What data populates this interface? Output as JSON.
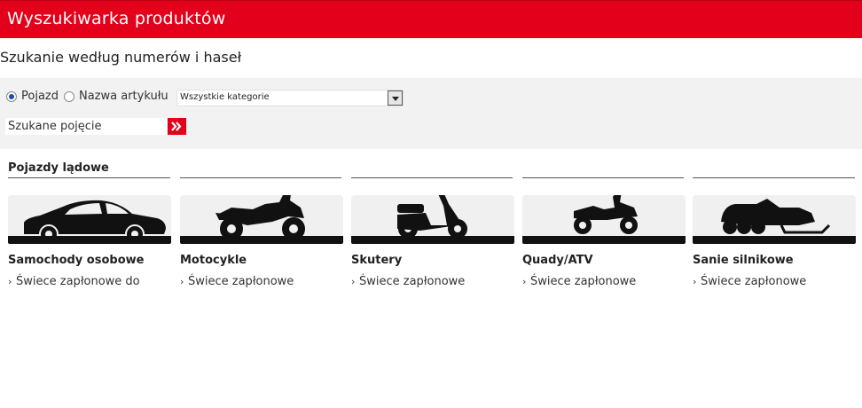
{
  "header": {
    "title": "Wyszukiwarka produktów"
  },
  "subtitle": "Szukanie według numerów i haseł",
  "search": {
    "radio_vehicle": "Pojazd",
    "radio_article": "Nazwa artykułu",
    "category_selected": "Wszystkie kategorie",
    "input_placeholder": "Szukane pojęcie"
  },
  "section": {
    "title": "Pojazdy lądowe"
  },
  "categories": [
    {
      "title": "Samochody osobowe",
      "link": "Świece zapłonowe do",
      "icon": "car-icon"
    },
    {
      "title": "Motocykle",
      "link": "Świece zapłonowe",
      "icon": "motorcycle-icon"
    },
    {
      "title": "Skutery",
      "link": "Świece zapłonowe",
      "icon": "scooter-icon"
    },
    {
      "title": "Quady/ATV",
      "link": "Świece zapłonowe",
      "icon": "atv-icon"
    },
    {
      "title": "Sanie silnikowe",
      "link": "Świece zapłonowe",
      "icon": "snowmobile-icon"
    }
  ],
  "colors": {
    "brand_red": "#e2001a",
    "panel_gray": "#f2f2f2"
  }
}
